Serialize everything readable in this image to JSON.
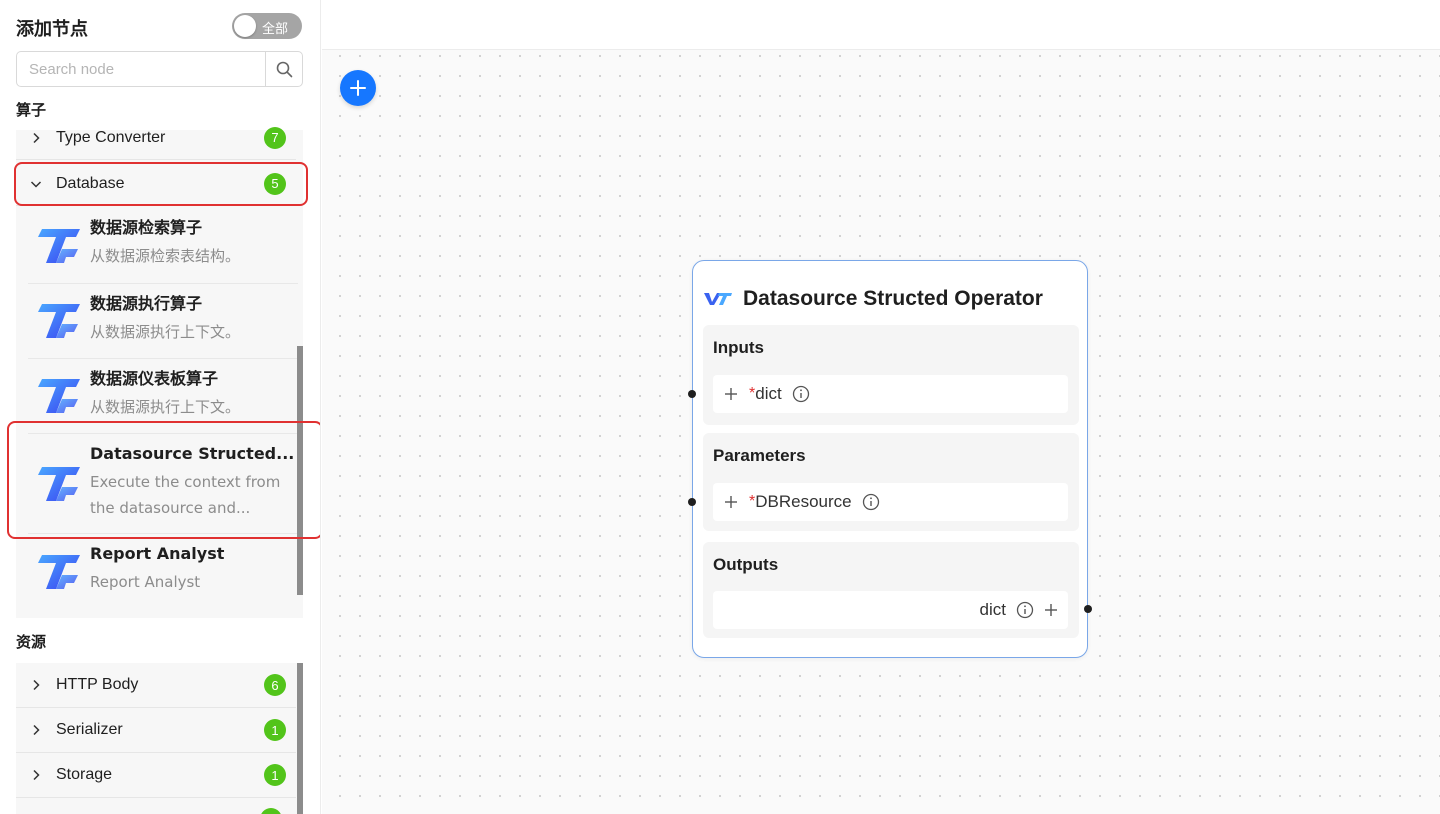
{
  "sidebar": {
    "title": "添加节点",
    "toggle_label": "全部",
    "search": {
      "placeholder": "Search node"
    },
    "operators_label": "算子",
    "resources_label": "资源",
    "operator_categories": [
      {
        "name": "Type Converter",
        "count": "7",
        "expanded": false
      },
      {
        "name": "Database",
        "count": "5",
        "expanded": true
      }
    ],
    "database_nodes": [
      {
        "title": "数据源检索算子",
        "desc_lines": [
          "从数据源检索表结构。"
        ]
      },
      {
        "title": "数据源执行算子",
        "desc_lines": [
          "从数据源执行上下文。"
        ]
      },
      {
        "title": "数据源仪表板算子",
        "desc_lines": [
          "从数据源执行上下文。"
        ]
      },
      {
        "title": "Datasource Structed...",
        "desc_lines": [
          "Execute the context from",
          "the datasource and..."
        ]
      },
      {
        "title": "Report Analyst",
        "desc_lines": [
          "Report Analyst"
        ]
      }
    ],
    "resource_categories": [
      {
        "name": "HTTP Body",
        "count": "6"
      },
      {
        "name": "Serializer",
        "count": "1"
      },
      {
        "name": "Storage",
        "count": "1"
      }
    ]
  },
  "canvas": {
    "node": {
      "title": "Datasource Structed Operator",
      "inputs_label": "Inputs",
      "inputs": [
        {
          "required_mark": "*",
          "name": "dict"
        }
      ],
      "parameters_label": "Parameters",
      "parameters": [
        {
          "required_mark": "*",
          "name": "DBResource"
        }
      ],
      "outputs_label": "Outputs",
      "outputs": [
        {
          "name": "dict"
        }
      ]
    }
  },
  "colors": {
    "accent": "#1677ff",
    "badge": "#52c41a",
    "highlight": "#e03131",
    "node_border": "#7aa7e8"
  }
}
